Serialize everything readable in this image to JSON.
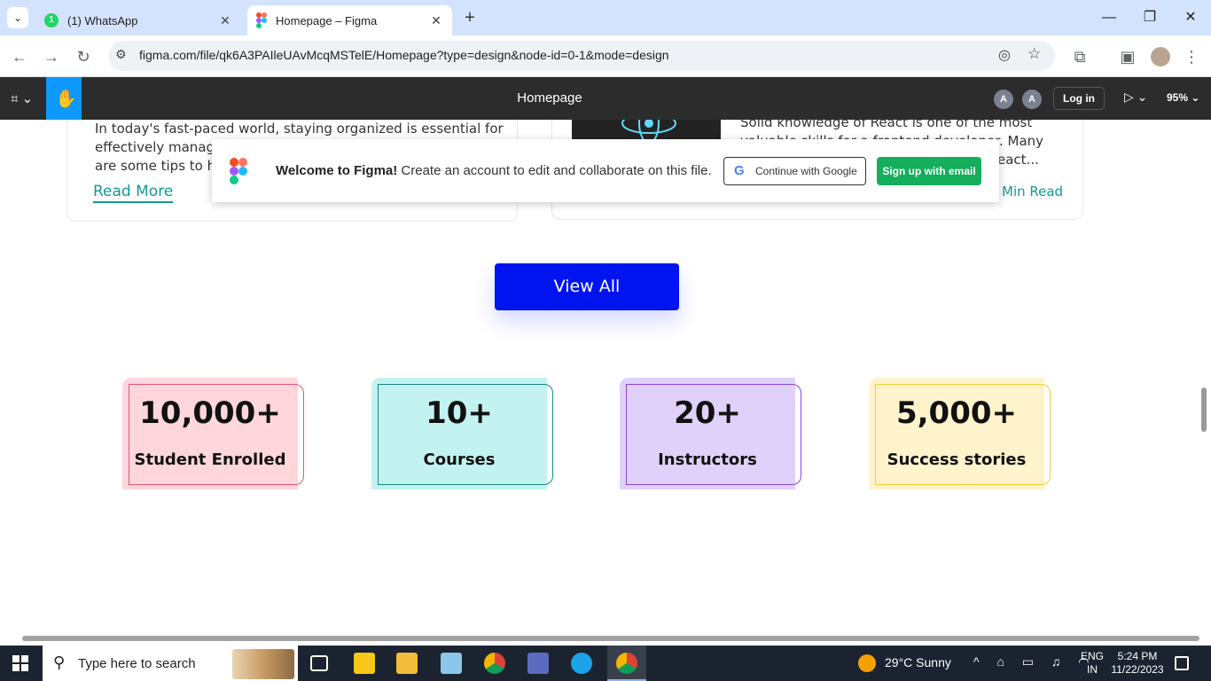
{
  "browser": {
    "tabs": [
      {
        "title": "(1) WhatsApp",
        "badge": "1"
      },
      {
        "title": "Homepage – Figma"
      }
    ],
    "url": "figma.com/file/qk6A3PAIleUAvMcqMSTelE/Homepage?type=design&node-id=0-1&mode=design"
  },
  "figma": {
    "file_title": "Homepage",
    "avatars": [
      "A",
      "A"
    ],
    "login_label": "Log in",
    "zoom": "95%"
  },
  "canvas": {
    "card_left": {
      "lines": [
        "In today's fast-paced world, staying organized is essential for",
        "effectively managir",
        "are some tips to he"
      ],
      "read_more": "Read More"
    },
    "card_right": {
      "lines": [
        "Solid knowledge of React is one of the most",
        "valuable skills for a frontend developer. Many",
        "eact..."
      ],
      "min_read": "Min Read"
    },
    "view_all": "View All",
    "stats": [
      {
        "number": "10,000+",
        "label": "Student Enrolled",
        "bg": "#ffd6dc",
        "border": "#e0587a"
      },
      {
        "number": "10+",
        "label": "Courses",
        "bg": "#c2f3f0",
        "border": "#1a8a80"
      },
      {
        "number": "20+",
        "label": "Instructors",
        "bg": "#e0d1fa",
        "border": "#8a45d8"
      },
      {
        "number": "5,000+",
        "label": "Success stories",
        "bg": "#fff3cc",
        "border": "#f0cf3a"
      }
    ]
  },
  "toast": {
    "title": "Welcome to Figma!",
    "message": "Create an account to edit and collaborate on this file.",
    "google_label": "Continue with Google",
    "email_label": "Sign up with email"
  },
  "taskbar": {
    "search_placeholder": "Type here to search",
    "weather": "29°C  Sunny",
    "lang": "ENG",
    "region": "IN",
    "time": "5:24 PM",
    "date": "11/22/2023"
  }
}
